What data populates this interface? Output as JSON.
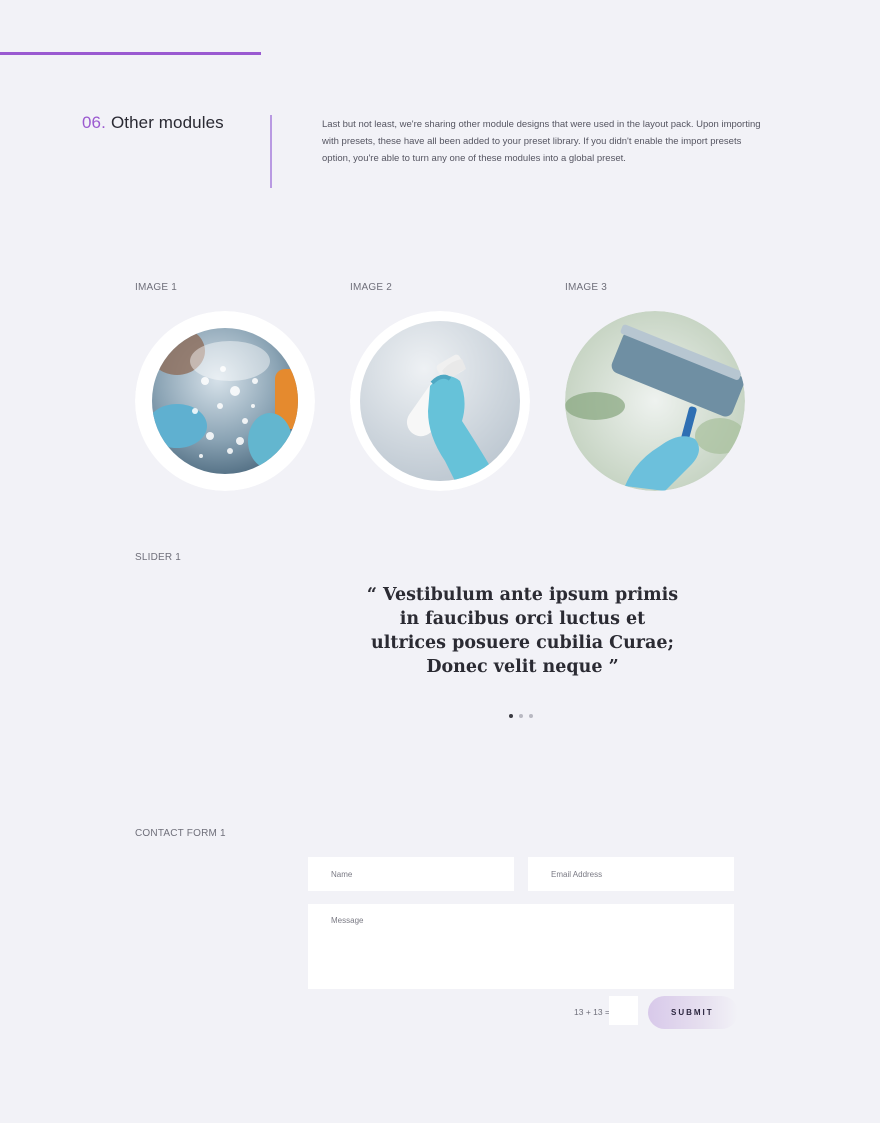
{
  "section": {
    "number": "06.",
    "title": "Other modules",
    "intro": "Last but not least, we're sharing other module designs that were used in the layout pack. Upon importing with presets, these have all been added to your preset library. If you didn't enable the import presets option, you're able to turn any one of these modules into a global preset."
  },
  "images": {
    "label_1": "IMAGE 1",
    "label_2": "IMAGE 2",
    "label_3": "IMAGE 3"
  },
  "slider": {
    "label": "SLIDER 1",
    "quote": "“ Vestibulum ante ipsum primis in faucibus orci luctus et ultrices posuere cubilia Curae; Donec velit neque ”",
    "slide_count": 3,
    "active_slide": 1
  },
  "contact": {
    "label": "CONTACT FORM 1",
    "name_placeholder": "Name",
    "email_placeholder": "Email Address",
    "message_placeholder": "Message",
    "captcha": "13 + 13 =",
    "submit_label": "SUBMIT"
  },
  "colors": {
    "accent": "#9a5ad1",
    "background": "#f2f2f7",
    "text": "#2b2b33"
  }
}
